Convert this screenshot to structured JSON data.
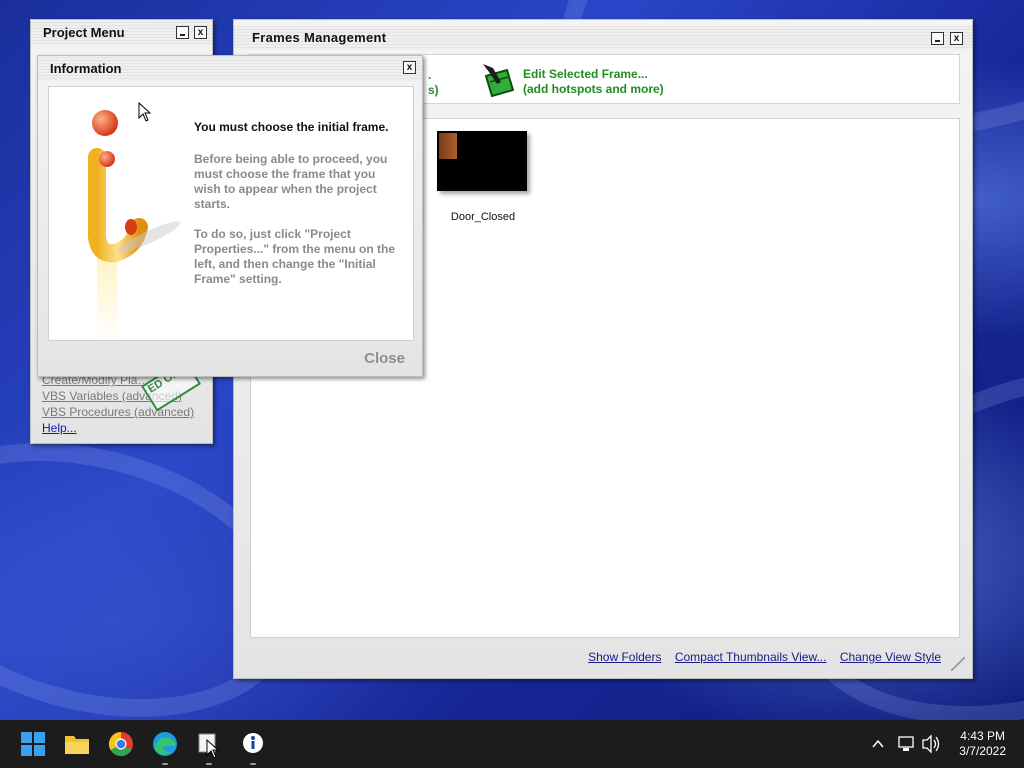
{
  "project_menu": {
    "title": "Project Menu",
    "links": [
      {
        "label": "Create/Modify Pla…"
      },
      {
        "label": "VBS Variables (advanced)"
      },
      {
        "label": "VBS Procedures (advanced)"
      },
      {
        "label": "Help..."
      }
    ],
    "stamp": "ED Only"
  },
  "frames_management": {
    "title": "Frames Management",
    "toolbar_fragment": ".\ns)",
    "edit_frame": {
      "line1": "Edit Selected Frame...",
      "line2": "(add hotspots and more)"
    },
    "frames": [
      {
        "name": "Door_Closed"
      }
    ],
    "footer_links": [
      "Show Folders",
      "Compact Thumbnails View...",
      "Change View Style"
    ]
  },
  "info_dialog": {
    "title": "Information",
    "heading": "You must choose the initial frame.",
    "paragraph1": "Before being able to proceed, you must choose the frame that you wish to appear when the project starts.",
    "paragraph2": "To do so, just click \"Project Properties...\" from the menu on the left, and then change the \"Initial Frame\" setting.",
    "close_label": "Close"
  },
  "taskbar": {
    "icons": [
      "start-icon",
      "file-explorer-icon",
      "chrome-icon",
      "edge-icon",
      "app-editor-icon",
      "info-app-icon"
    ],
    "time": "4:43 PM",
    "date": "3/7/2022"
  },
  "colors": {
    "accent_green": "#1e8e1e",
    "link_blue": "#1a1a88",
    "desktop_blue": "#2a45c8"
  }
}
